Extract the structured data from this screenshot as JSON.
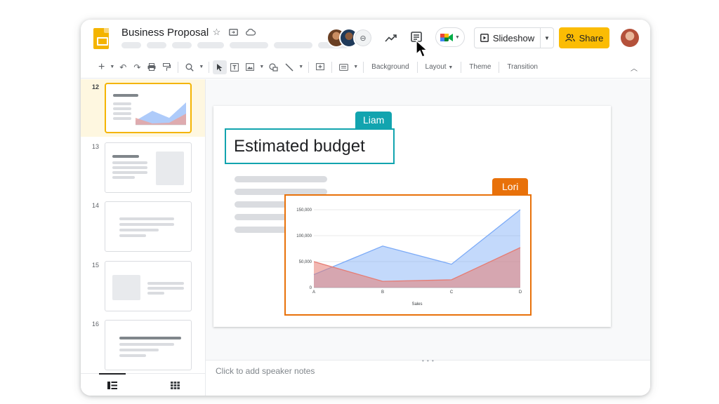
{
  "header": {
    "doc_title": "Business Proposal",
    "title_icons": [
      "star-icon",
      "folder-move-icon",
      "cloud-status-icon"
    ],
    "collaborators": [
      "collaborator-1",
      "collaborator-2",
      "collaborator-more"
    ],
    "slideshow_label": "Slideshow",
    "share_label": "Share",
    "brand_color": "#fbbc04"
  },
  "toolbar": {
    "background_label": "Background",
    "layout_label": "Layout",
    "theme_label": "Theme",
    "transition_label": "Transition"
  },
  "filmstrip": {
    "slides": [
      {
        "number": "12",
        "active": true
      },
      {
        "number": "13",
        "active": false
      },
      {
        "number": "14",
        "active": false
      },
      {
        "number": "15",
        "active": false
      },
      {
        "number": "16",
        "active": false
      }
    ]
  },
  "slide": {
    "title": "Estimated budget",
    "cursor_tags": [
      {
        "name": "Liam",
        "color": "#12a4af"
      },
      {
        "name": "Lori",
        "color": "#e8710a"
      }
    ]
  },
  "chart_data": {
    "type": "area",
    "categories": [
      "A",
      "B",
      "C",
      "D"
    ],
    "series": [
      {
        "values": [
          25000,
          80000,
          45000,
          150000
        ],
        "color": "#7baaf7"
      },
      {
        "values": [
          50000,
          12000,
          15000,
          77000
        ],
        "color": "#e67c73"
      }
    ],
    "yticks": [
      "0",
      "50,000",
      "100,000",
      "150,000"
    ],
    "ylim": [
      0,
      150000
    ],
    "xlabel": "Sales",
    "grid": true
  },
  "notes": {
    "placeholder": "Click to add speaker notes"
  }
}
